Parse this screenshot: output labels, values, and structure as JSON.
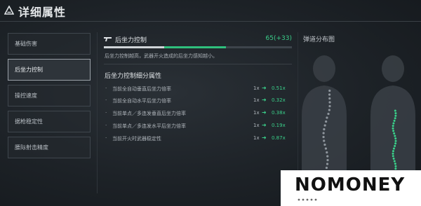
{
  "header": {
    "title": "详细属性",
    "icon": "triangle-logo-icon"
  },
  "sidebar": {
    "items": [
      {
        "label": "基础伤害",
        "active": false
      },
      {
        "label": "后坐力控制",
        "active": true
      },
      {
        "label": "操控速度",
        "active": false
      },
      {
        "label": "据枪稳定性",
        "active": false
      },
      {
        "label": "腰际射击精度",
        "active": false
      }
    ]
  },
  "stat": {
    "title": "后坐力控制",
    "value": "65(+33)",
    "base_fraction": 0.32,
    "bonus_fraction": 0.33,
    "description": "后坐力控制越高，武器开火造成的后坐力感知越小。"
  },
  "breakdown": {
    "title": "后坐力控制细分属性",
    "rows": [
      {
        "bullet": "·",
        "label": "当前全自动垂直后坐力倍率",
        "base": "1x",
        "value": "0.51x"
      },
      {
        "bullet": "·",
        "label": "当前全自动水平后坐力倍率",
        "base": "1x",
        "value": "0.32x"
      },
      {
        "bullet": "·",
        "label": "当前单点／多连发垂直后坐力倍率",
        "base": "1x",
        "value": "0.38x"
      },
      {
        "bullet": "·",
        "label": "当前单点／多连发水平后坐力倍率",
        "base": "1x",
        "value": "0.19x"
      },
      {
        "bullet": "·",
        "label": "当前开火时武器稳定性",
        "base": "1x",
        "value": "0.87x"
      }
    ]
  },
  "trajectory": {
    "title": "弹道分布图"
  },
  "watermark": {
    "text": "NOMONEY"
  },
  "colors": {
    "accent_green": "#3ad08a",
    "background": "#1b2026",
    "active_border": "#9aa1a8"
  }
}
